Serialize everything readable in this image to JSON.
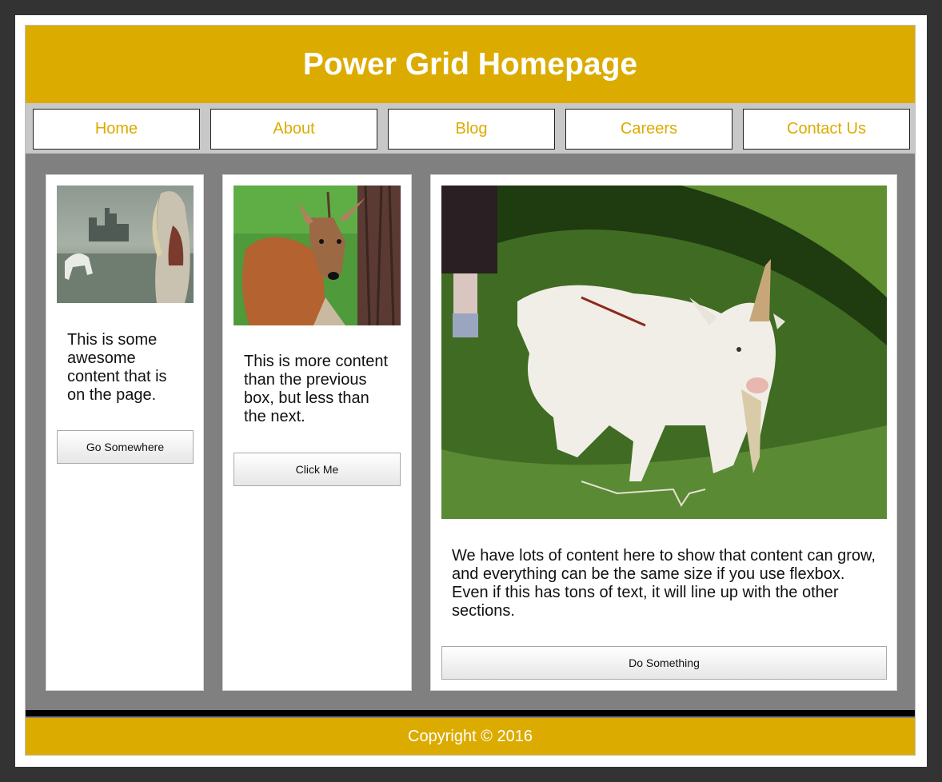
{
  "header": {
    "title": "Power Grid Homepage"
  },
  "nav": {
    "items": [
      "Home",
      "About",
      "Blog",
      "Careers",
      "Contact Us"
    ]
  },
  "cards": [
    {
      "text": "This is some awesome content that is on the page.",
      "button": "Go Somewhere",
      "image": "castle-horse-woman-painting"
    },
    {
      "text": "This is more content than the previous box, but less than the next.",
      "button": "Click Me",
      "image": "deer-photo"
    },
    {
      "text": "We have lots of content here to show that content can grow, and everything can be the same size if you use flexbox. Even if this has tons of text, it will line up with the other sections.",
      "button": "Do Something",
      "image": "white-goat-photo"
    }
  ],
  "footer": {
    "text": "Copyright © 2016"
  },
  "colors": {
    "brand": "#dcab00",
    "background": "#808080",
    "nav_background": "#c8c8c8",
    "outer": "#333333"
  }
}
